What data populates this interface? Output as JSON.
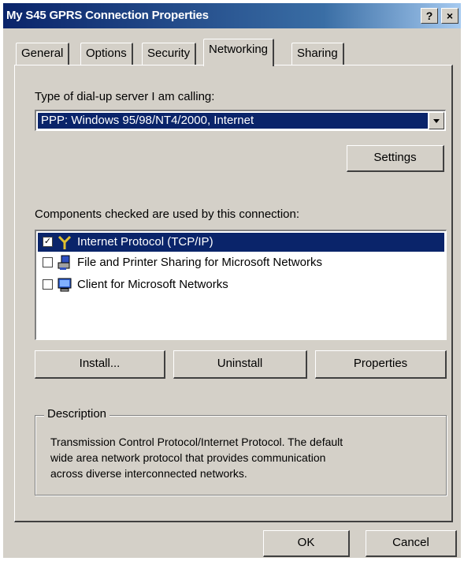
{
  "window": {
    "title": "My S45 GPRS Connection Properties",
    "help_label": "?",
    "close_label": "×"
  },
  "tabs": [
    {
      "label": "General"
    },
    {
      "label": "Options"
    },
    {
      "label": "Security"
    },
    {
      "label": "Networking",
      "active": true
    },
    {
      "label": "Sharing"
    }
  ],
  "server_type": {
    "label": "Type of dial-up server I am calling:",
    "selected": "PPP: Windows 95/98/NT4/2000, Internet"
  },
  "settings_button": "Settings",
  "components": {
    "label": "Components checked are used by this connection:",
    "items": [
      {
        "label": "Internet Protocol (TCP/IP)",
        "checked": true,
        "icon": "network-protocol-icon",
        "selected": true
      },
      {
        "label": "File and Printer Sharing for Microsoft Networks",
        "checked": false,
        "icon": "printer-sharing-icon"
      },
      {
        "label": "Client for Microsoft Networks",
        "checked": false,
        "icon": "network-client-icon"
      }
    ]
  },
  "component_buttons": {
    "install": "Install...",
    "uninstall": "Uninstall",
    "properties": "Properties"
  },
  "description": {
    "legend": "Description",
    "line1": "Transmission Control Protocol/Internet Protocol. The default",
    "line2": "wide area network protocol that provides communication",
    "line3": "across diverse interconnected networks."
  },
  "footer": {
    "ok": "OK",
    "cancel": "Cancel"
  },
  "colors": {
    "title_bar": "#0a246a",
    "face": "#d4d0c8",
    "selection": "#0a246a"
  }
}
